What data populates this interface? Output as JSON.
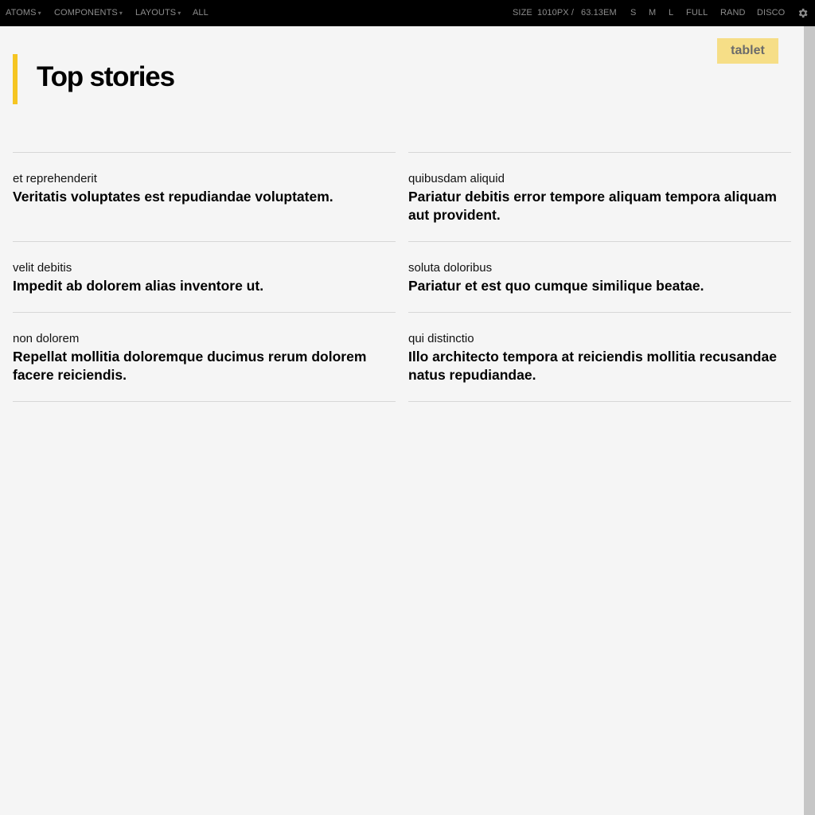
{
  "toolbar": {
    "atoms": "ATOMS",
    "components": "COMPONENTS",
    "layouts": "LAYOUTS",
    "all": "ALL",
    "size_label": "SIZE",
    "size_px": "1010PX /",
    "size_em": "63.13EM",
    "s": "S",
    "m": "M",
    "l": "L",
    "full": "FULL",
    "rand": "RAND",
    "disco": "DISCO",
    "gear_icon": "gear-icon",
    "caret_icon": "▾"
  },
  "badge": {
    "label": "tablet"
  },
  "page": {
    "title": "Top stories"
  },
  "stories": [
    {
      "kicker": "et reprehenderit",
      "headline": "Veritatis voluptates est repudiandae voluptatem."
    },
    {
      "kicker": "quibusdam aliquid",
      "headline": "Pariatur debitis error tempore aliquam tempora aliquam aut provident."
    },
    {
      "kicker": "velit debitis",
      "headline": "Impedit ab dolorem alias inventore ut."
    },
    {
      "kicker": "soluta doloribus",
      "headline": "Pariatur et est quo cumque similique beatae."
    },
    {
      "kicker": "non dolorem",
      "headline": "Repellat mollitia doloremque ducimus rerum dolorem facere reiciendis."
    },
    {
      "kicker": "qui distinctio",
      "headline": "Illo architecto tempora at reiciendis mollitia recusandae natus repudiandae."
    }
  ],
  "colors": {
    "toolbar_bg": "#000000",
    "accent": "#f5c522",
    "badge_bg": "#f6de87",
    "page_bg": "#f5f5f5"
  }
}
